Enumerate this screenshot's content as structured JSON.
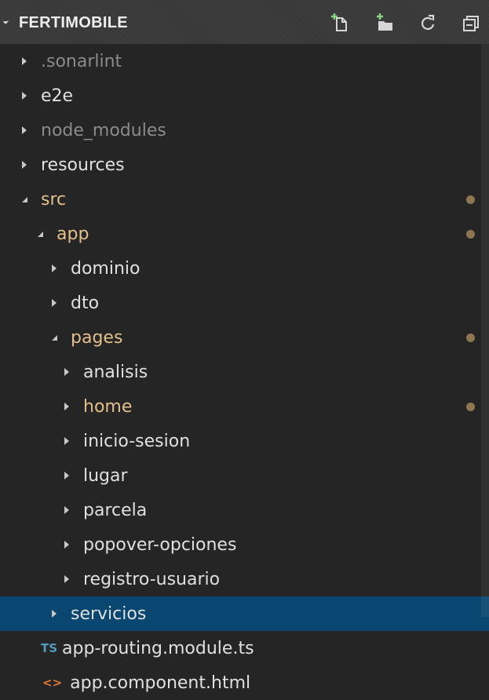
{
  "header": {
    "title": "FERTIMOBILE",
    "actions": [
      {
        "name": "new-file-icon"
      },
      {
        "name": "new-folder-icon"
      },
      {
        "name": "refresh-icon"
      },
      {
        "name": "collapse-all-icon"
      }
    ]
  },
  "tree": {
    "items": [
      {
        "label": ".sonarlint",
        "state": "collapsed",
        "style": "dim"
      },
      {
        "label": "e2e",
        "state": "collapsed",
        "style": "normal"
      },
      {
        "label": "node_modules",
        "state": "collapsed",
        "style": "dim"
      },
      {
        "label": "resources",
        "state": "collapsed",
        "style": "normal"
      },
      {
        "label": "src",
        "state": "expanded",
        "style": "modified",
        "dot": true
      },
      {
        "label": "app",
        "state": "expanded",
        "style": "modified",
        "dot": true
      },
      {
        "label": "dominio",
        "state": "collapsed",
        "style": "normal"
      },
      {
        "label": "dto",
        "state": "collapsed",
        "style": "normal"
      },
      {
        "label": "pages",
        "state": "expanded",
        "style": "modified",
        "dot": true
      },
      {
        "label": "analisis",
        "state": "collapsed",
        "style": "normal"
      },
      {
        "label": "home",
        "state": "collapsed",
        "style": "modified",
        "dot": true
      },
      {
        "label": "inicio-sesion",
        "state": "collapsed",
        "style": "normal"
      },
      {
        "label": "lugar",
        "state": "collapsed",
        "style": "normal"
      },
      {
        "label": "parcela",
        "state": "collapsed",
        "style": "normal"
      },
      {
        "label": "popover-opciones",
        "state": "collapsed",
        "style": "normal"
      },
      {
        "label": "registro-usuario",
        "state": "collapsed",
        "style": "normal"
      },
      {
        "label": "servicios",
        "state": "collapsed",
        "style": "normal",
        "selected": true
      },
      {
        "label": "app-routing.module.ts",
        "file_icon": "TS",
        "file_icon_color": "#519aba",
        "style": "normal"
      },
      {
        "label": "app.component.html",
        "file_icon": "<>",
        "file_icon_color": "#e37933",
        "style": "normal"
      }
    ]
  },
  "colors": {
    "background": "#252526",
    "header": "#383838",
    "selected": "#094771",
    "modified": "#e2c08d",
    "dot": "#8e7652"
  }
}
